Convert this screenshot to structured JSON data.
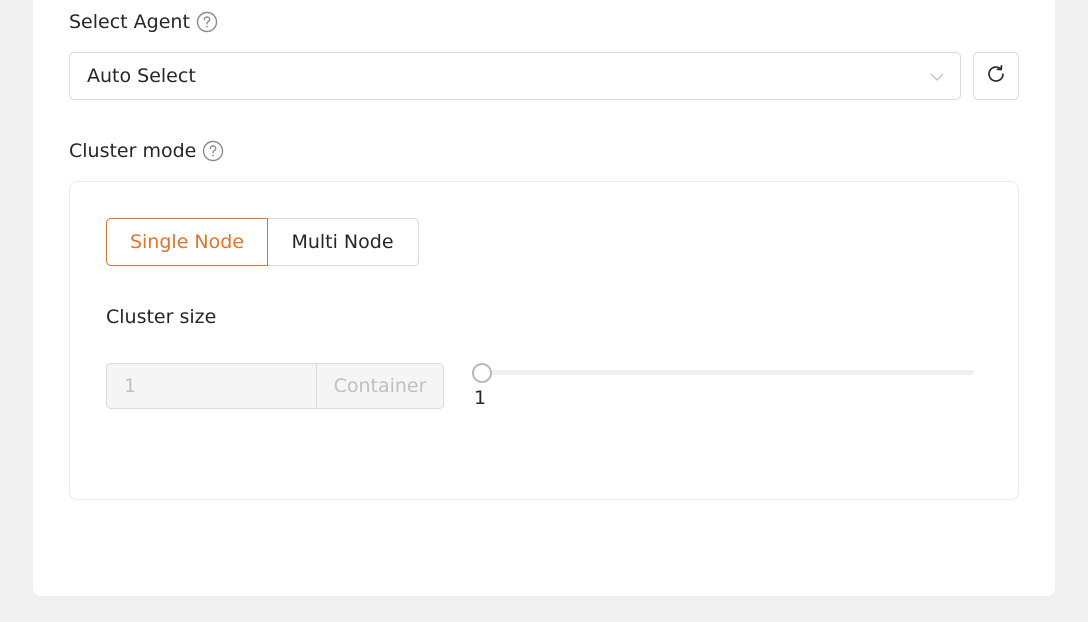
{
  "agent": {
    "label": "Select Agent",
    "selected": "Auto Select"
  },
  "cluster_mode": {
    "label": "Cluster mode",
    "options": [
      "Single Node",
      "Multi Node"
    ],
    "selected": "Single Node"
  },
  "cluster_size": {
    "label": "Cluster size",
    "value": "1",
    "unit": "Container",
    "slider_value": 1,
    "slider_mark": "1"
  },
  "colors": {
    "accent": "#e0732b",
    "border": "#d9d9d9",
    "disabled_text": "#bfbfbf"
  }
}
